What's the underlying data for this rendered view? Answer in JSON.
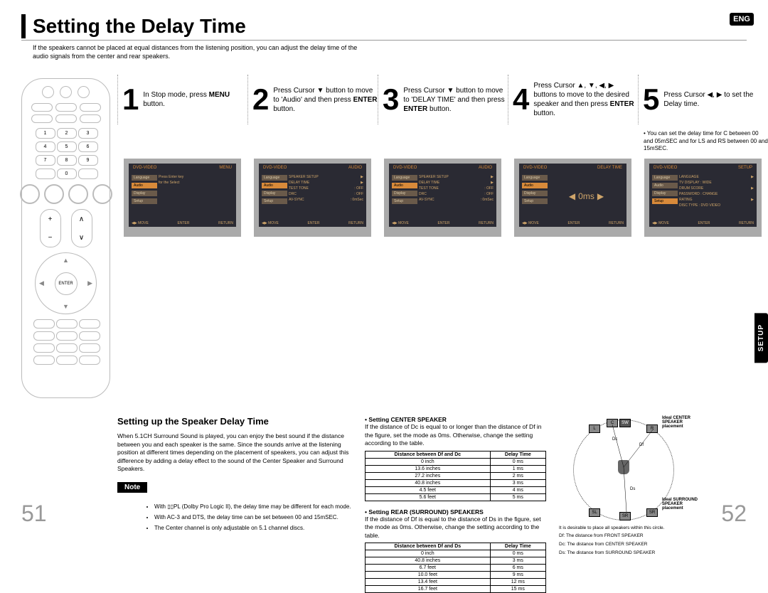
{
  "header": {
    "title": "Setting the Delay Time",
    "intro": "If the speakers cannot be placed at equal distances from the listening position, you can adjust the delay time of the audio signals from the center and rear speakers.",
    "lang_badge": "ENG",
    "side_tab": "SETUP"
  },
  "remote": {
    "enter": "ENTER",
    "nums": [
      "1",
      "2",
      "3",
      "4",
      "5",
      "6",
      "7",
      "8",
      "9",
      "0"
    ]
  },
  "steps": [
    {
      "num": "1",
      "txt_pre": "In Stop mode, press ",
      "txt_bold": "MENU",
      "txt_post": " button."
    },
    {
      "num": "2",
      "txt_pre": "Press Cursor ▼ button to move to 'Audio' and then press ",
      "txt_bold": "ENTER",
      "txt_post": " button."
    },
    {
      "num": "3",
      "txt_pre": "Press Cursor ▼ button to move to 'DELAY TIME' and then press ",
      "txt_bold": "ENTER",
      "txt_post": " button."
    },
    {
      "num": "4",
      "txt_pre": "Press Cursor ▲, ▼, ◀, ▶ buttons to move to the desired speaker and then press ",
      "txt_bold": "ENTER",
      "txt_post": " button."
    },
    {
      "num": "5",
      "txt_pre": "Press Cursor ◀, ▶ to set the Delay time.",
      "txt_bold": "",
      "txt_post": ""
    }
  ],
  "step_note": "You can set the delay time for C between 00 and 05mSEC and for LS and RS between 00 and 15mSEC.",
  "screens": {
    "top_label": "DVD-VIDEO",
    "s1": {
      "title": "MENU",
      "side": [
        "Language",
        "Audio",
        "Display",
        "Setup"
      ],
      "sel": 1,
      "main": [
        "Press Enter key",
        "for the Select"
      ]
    },
    "s2": {
      "title": "AUDIO",
      "side": [
        "Language",
        "Audio",
        "Display",
        "Setup"
      ],
      "sel": 1,
      "main": [
        "SPEAKER SETUP",
        "DELAY TIME",
        "TEST TONE",
        "DRC",
        "AV-SYNC"
      ],
      "vals": [
        "",
        ": √",
        ": OFF",
        ": OFF",
        ": 0mSec"
      ]
    },
    "s3": {
      "title": "AUDIO",
      "side": [
        "Language",
        "Audio",
        "Display",
        "Setup"
      ],
      "sel": 1,
      "main": [
        "SPEAKER SETUP",
        "DELAY TIME",
        "TEST TONE",
        "DRC",
        "AV-SYNC"
      ],
      "vals": [
        "",
        ": √",
        ": OFF",
        ": OFF",
        ": 0mSec"
      ]
    },
    "s4": {
      "title": "DELAY TIME",
      "side": [
        "Language",
        "Audio",
        "Display",
        "Setup"
      ],
      "sel": 1,
      "big": "0ms"
    },
    "s5": {
      "title": "SETUP",
      "side": [
        "Language",
        "Audio",
        "Display",
        "Setup"
      ],
      "sel": 3,
      "main": [
        "LANGUAGE",
        "TV DISPLAY : WIDE",
        "DRUM SCORE",
        "PASSWORD : CHANGE",
        "RATING",
        "DISC TYPE : DVD VIDEO"
      ]
    },
    "bottom": [
      "◀▶ MOVE",
      "ENTER",
      "RETURN"
    ]
  },
  "lower": {
    "subhead": "Setting up the Speaker Delay Time",
    "body": "When 5.1CH Surround Sound is played, you can enjoy the best sound if the distance between you and each speaker is the same. Since the sounds arrive at the listening position at different times depending on the placement of speakers, you can adjust this difference by adding a delay effect to the sound of the Center Speaker and Surround Speakers.",
    "note_label": "Note",
    "notes": [
      "With ▯▯PL (Dolby Pro Logic II), the delay time may be different for each mode.",
      "With AC-3 and DTS, the delay time can be set between 00 and 15mSEC.",
      "The Center channel is only adjustable on 5.1 channel discs."
    ],
    "center_head": "Setting CENTER SPEAKER",
    "center_txt": "If the distance of Dc is equal to or longer than the distance of Df in the figure, set the mode as 0ms. Otherwise, change the setting according to the table.",
    "rear_head": "Setting REAR (SURROUND) SPEAKERS",
    "rear_txt": "If the distance of Df is equal to the distance of Ds in the figure, set the mode as 0ms. Otherwise, change the setting according to the table.",
    "table1": {
      "h1": "Distance between Df and Dc",
      "h2": "Delay Time",
      "rows": [
        [
          "0 inch",
          "0 ms"
        ],
        [
          "13.6 inches",
          "1 ms"
        ],
        [
          "27.2 inches",
          "2 ms"
        ],
        [
          "40.8 inches",
          "3 ms"
        ],
        [
          "4.5 feet",
          "4 ms"
        ],
        [
          "5.6 feet",
          "5 ms"
        ]
      ]
    },
    "table2": {
      "h1": "Distance between Df and Ds",
      "h2": "Delay Time",
      "rows": [
        [
          "0 inch",
          "0 ms"
        ],
        [
          "40.8 inches",
          "3 ms"
        ],
        [
          "6.7 feet",
          "6 ms"
        ],
        [
          "10.0 feet",
          "9 ms"
        ],
        [
          "13.4 feet",
          "12 ms"
        ],
        [
          "16.7 feet",
          "15 ms"
        ]
      ]
    },
    "diagram": {
      "ideal_center": "Ideal CENTER SPEAKER placement",
      "ideal_surround": "Ideal SURROUND SPEAKER placement",
      "circle_note": "It is desirable to place all speakers within this circle.",
      "df": "Df: The distance from FRONT SPEAKER",
      "dc": "Dc: The distance from CENTER SPEAKER",
      "ds": "Ds: The distance from SURROUND SPEAKER",
      "labels": {
        "L": "L",
        "C": "C",
        "SW": "SW",
        "R": "R",
        "SL": "SL",
        "SR": "SR",
        "Dc": "Dc",
        "Df": "Df",
        "Ds": "Ds"
      }
    }
  },
  "page_numbers": {
    "left": "51",
    "right": "52"
  }
}
